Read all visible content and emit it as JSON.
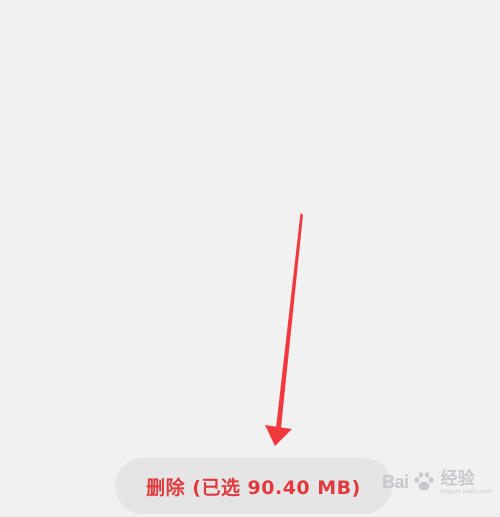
{
  "footer": {
    "delete_button_label": "删除 (已选 90.40 MB)"
  },
  "watermark": {
    "brand_text": "Bai",
    "logo_icon": "paw-icon",
    "service_text": "经验",
    "url_text": "jingyan.baidu.com"
  },
  "colors": {
    "background": "#f1f1f2",
    "button_background": "#e5e5e6",
    "button_text": "#e03a3e",
    "annotation_arrow": "#f0383d",
    "watermark": "#c9c9cc"
  }
}
